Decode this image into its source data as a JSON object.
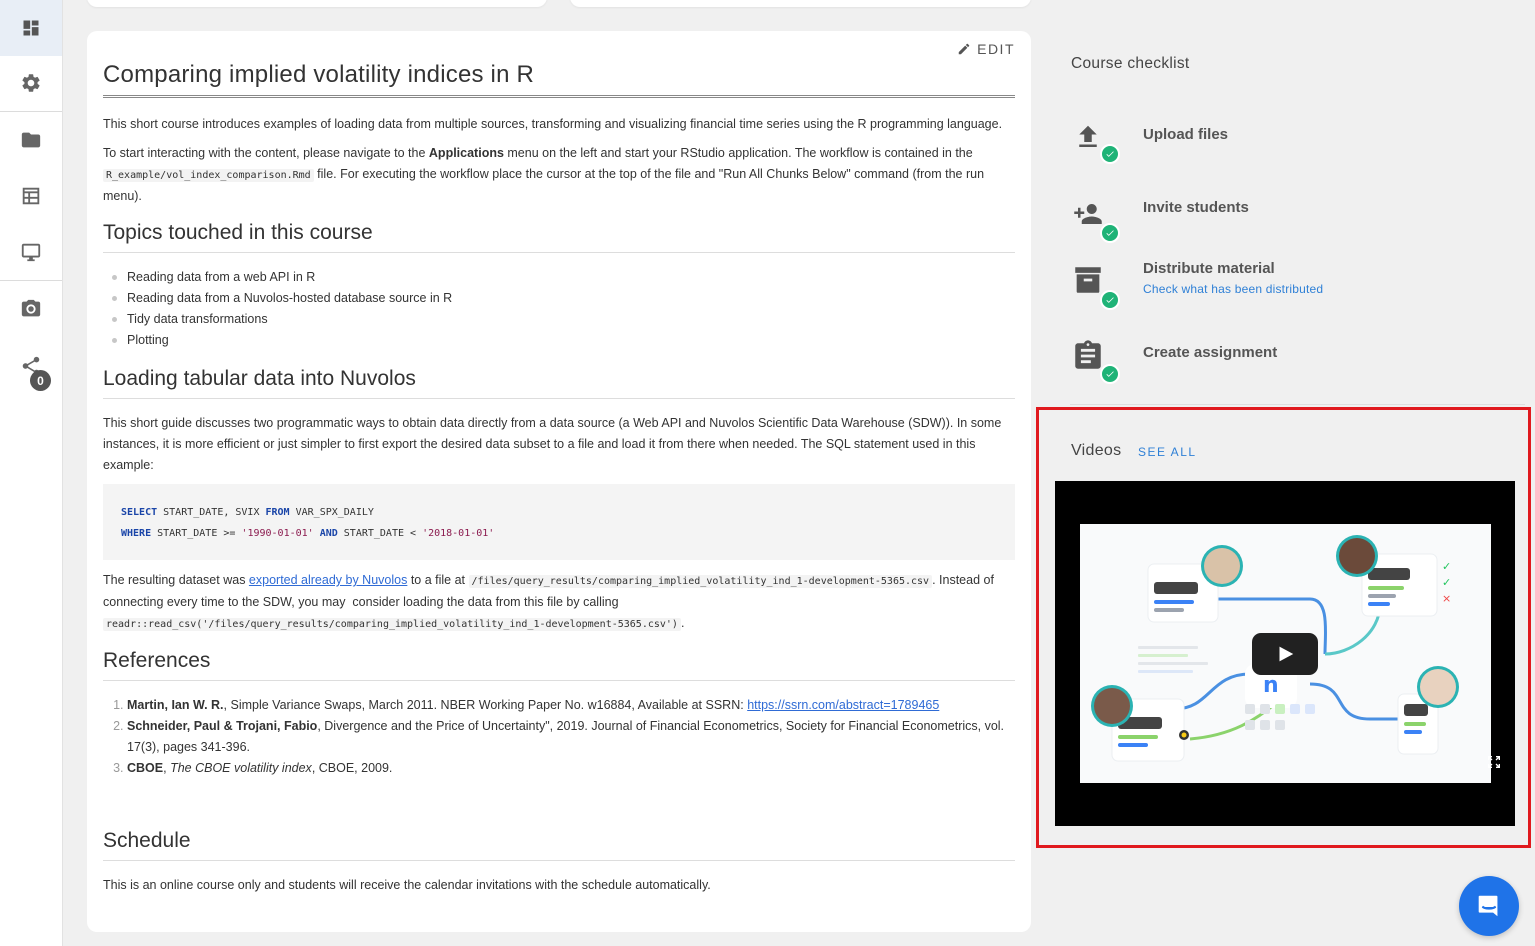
{
  "sidebar": {
    "items": [
      {
        "name": "dashboard-icon"
      },
      {
        "name": "gear-icon"
      },
      {
        "name": "folder-icon"
      },
      {
        "name": "table-icon"
      },
      {
        "name": "monitor-icon"
      },
      {
        "name": "camera-icon"
      },
      {
        "name": "share-icon",
        "badge": "0"
      }
    ]
  },
  "course": {
    "edit_label": "EDIT",
    "title": "Comparing implied volatility indices in R",
    "intro": "This short course introduces examples of loading data from multiple sources, transforming and visualizing financial time series using the R programming language.",
    "start_p1": "To start interacting with the content, please navigate to the ",
    "start_bold": "Applications",
    "start_p2": " menu on the left and start your RStudio application. The workflow is contained in the ",
    "start_code": "R_example/vol_index_comparison.Rmd",
    "start_p3": " file. For executing the workflow place the cursor at the top of the file and \"Run All Chunks Below\" command (from the run menu).",
    "topics_heading": "Topics touched in this course",
    "topics": [
      "Reading data from a web API in R",
      "Reading data from a Nuvolos-hosted database source in R",
      "Tidy data transformations",
      "Plotting"
    ],
    "loading_heading": "Loading tabular data into Nuvolos",
    "loading_text": "This short guide discusses two programmatic ways to obtain data directly from a data source (a Web API and Nuvolos Scientific Data Warehouse (SDW)). In some instances, it is more efficient or just simpler to first export the desired data subset to a file and load it from there when needed. The SQL statement used in this example:",
    "sql": {
      "l1_kw1": "SELECT",
      "l1_mid": " START_DATE, SVIX ",
      "l1_kw2": "FROM",
      "l1_tail": " VAR_SPX_DAILY",
      "l2_kw1": "WHERE",
      "l2_mid": " START_DATE >= ",
      "l2_str1": "'1990-01-01'",
      "l2_kw2": " AND",
      "l2_mid2": " START_DATE < ",
      "l2_str2": "'2018-01-01'"
    },
    "result_p1": "The resulting dataset was ",
    "result_link": "exported already by Nuvolos",
    "result_p2": " to a file at ",
    "result_code1": "/files/query_results/comparing_implied_volatility_ind_1-development-5365.csv",
    "result_p3": ". Instead of connecting every time to the SDW, you may  consider loading the data from this file by calling ",
    "result_code2": "readr::read_csv('/files/query_results/comparing_implied_volatility_ind_1-development-5365.csv')",
    "result_p4": ".",
    "references_heading": "References",
    "references": [
      {
        "bold": "Martin, Ian W. R.",
        "text": ", Simple Variance Swaps, March 2011. NBER Working Paper No. w16884, Available at SSRN: ",
        "link": "https://ssrn.com/abstract=1789465"
      },
      {
        "bold": "Schneider, Paul & Trojani, Fabio",
        "text": ", Divergence and the Price of Uncertainty\", 2019. Journal of Financial Econometrics, Society for Financial Econometrics, vol. 17(3), pages 341-396."
      },
      {
        "bold": "CBOE",
        "italic": "The CBOE volatility index",
        "text": ", CBOE, 2009."
      }
    ],
    "schedule_heading": "Schedule",
    "schedule_text": "This is an online course only and students will receive the calendar invitations with the schedule automatically."
  },
  "checklist": {
    "title": "Course checklist",
    "items": [
      {
        "label": "Upload files",
        "icon": "upload-icon"
      },
      {
        "label": "Invite students",
        "icon": "add-person-icon"
      },
      {
        "label": "Distribute material",
        "icon": "archive-icon",
        "link": "Check what has been distributed"
      },
      {
        "label": "Create assignment",
        "icon": "clipboard-icon"
      }
    ]
  },
  "videos": {
    "title": "Videos",
    "see_all": "SEE ALL"
  },
  "colors": {
    "accent": "#2f80d6",
    "check_green": "#1fb377",
    "highlight_red": "#e0191e",
    "chat_blue": "#1f73e8"
  }
}
